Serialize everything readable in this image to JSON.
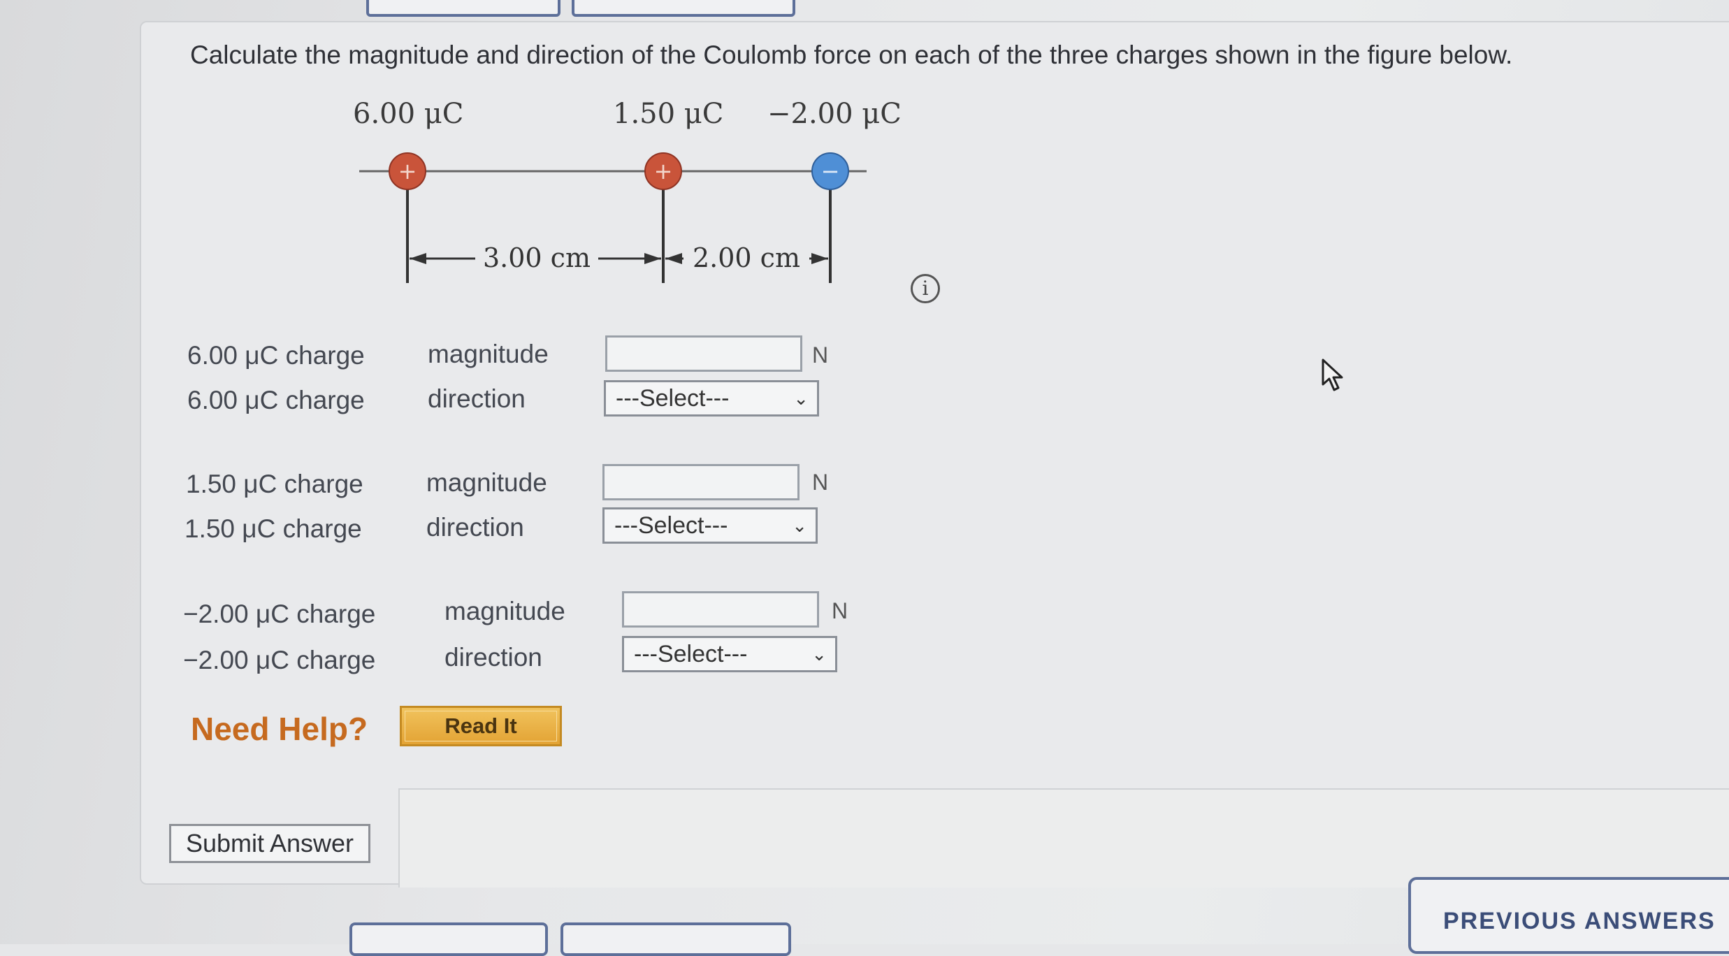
{
  "question": {
    "text": "Calculate the magnitude and direction of the Coulomb force on each of the three charges shown in the figure below."
  },
  "figure": {
    "charge_labels": [
      "6.00 μC",
      "1.50 μC",
      "−2.00 μC"
    ],
    "charge_signs": [
      "+",
      "+",
      "−"
    ],
    "distance_labels": [
      "3.00 cm",
      "2.00 cm"
    ],
    "positive_color": "#c9543a",
    "negative_color": "#4f8fd6"
  },
  "rows": [
    {
      "magnitude_label": "6.00 μC charge",
      "magnitude_word": "magnitude",
      "magnitude_value": "",
      "unit": "N",
      "direction_label": "6.00 μC charge",
      "direction_word": "direction",
      "direction_selected": "---Select---"
    },
    {
      "magnitude_label": "1.50 μC charge",
      "magnitude_word": "magnitude",
      "magnitude_value": "",
      "unit": "N",
      "direction_label": "1.50 μC charge",
      "direction_word": "direction",
      "direction_selected": "---Select---"
    },
    {
      "magnitude_label": "−2.00 μC charge",
      "magnitude_word": "magnitude",
      "magnitude_value": "",
      "unit": "N",
      "direction_label": "−2.00 μC charge",
      "direction_word": "direction",
      "direction_selected": "---Select---"
    }
  ],
  "help": {
    "need_help": "Need Help?",
    "read_it": "Read It"
  },
  "submit_label": "Submit Answer",
  "previous_answers_label": "PREVIOUS ANSWERS",
  "icons": {
    "info": "info-circle-icon",
    "dropdown": "chevron-down-icon",
    "cursor": "mouse-pointer-icon"
  }
}
